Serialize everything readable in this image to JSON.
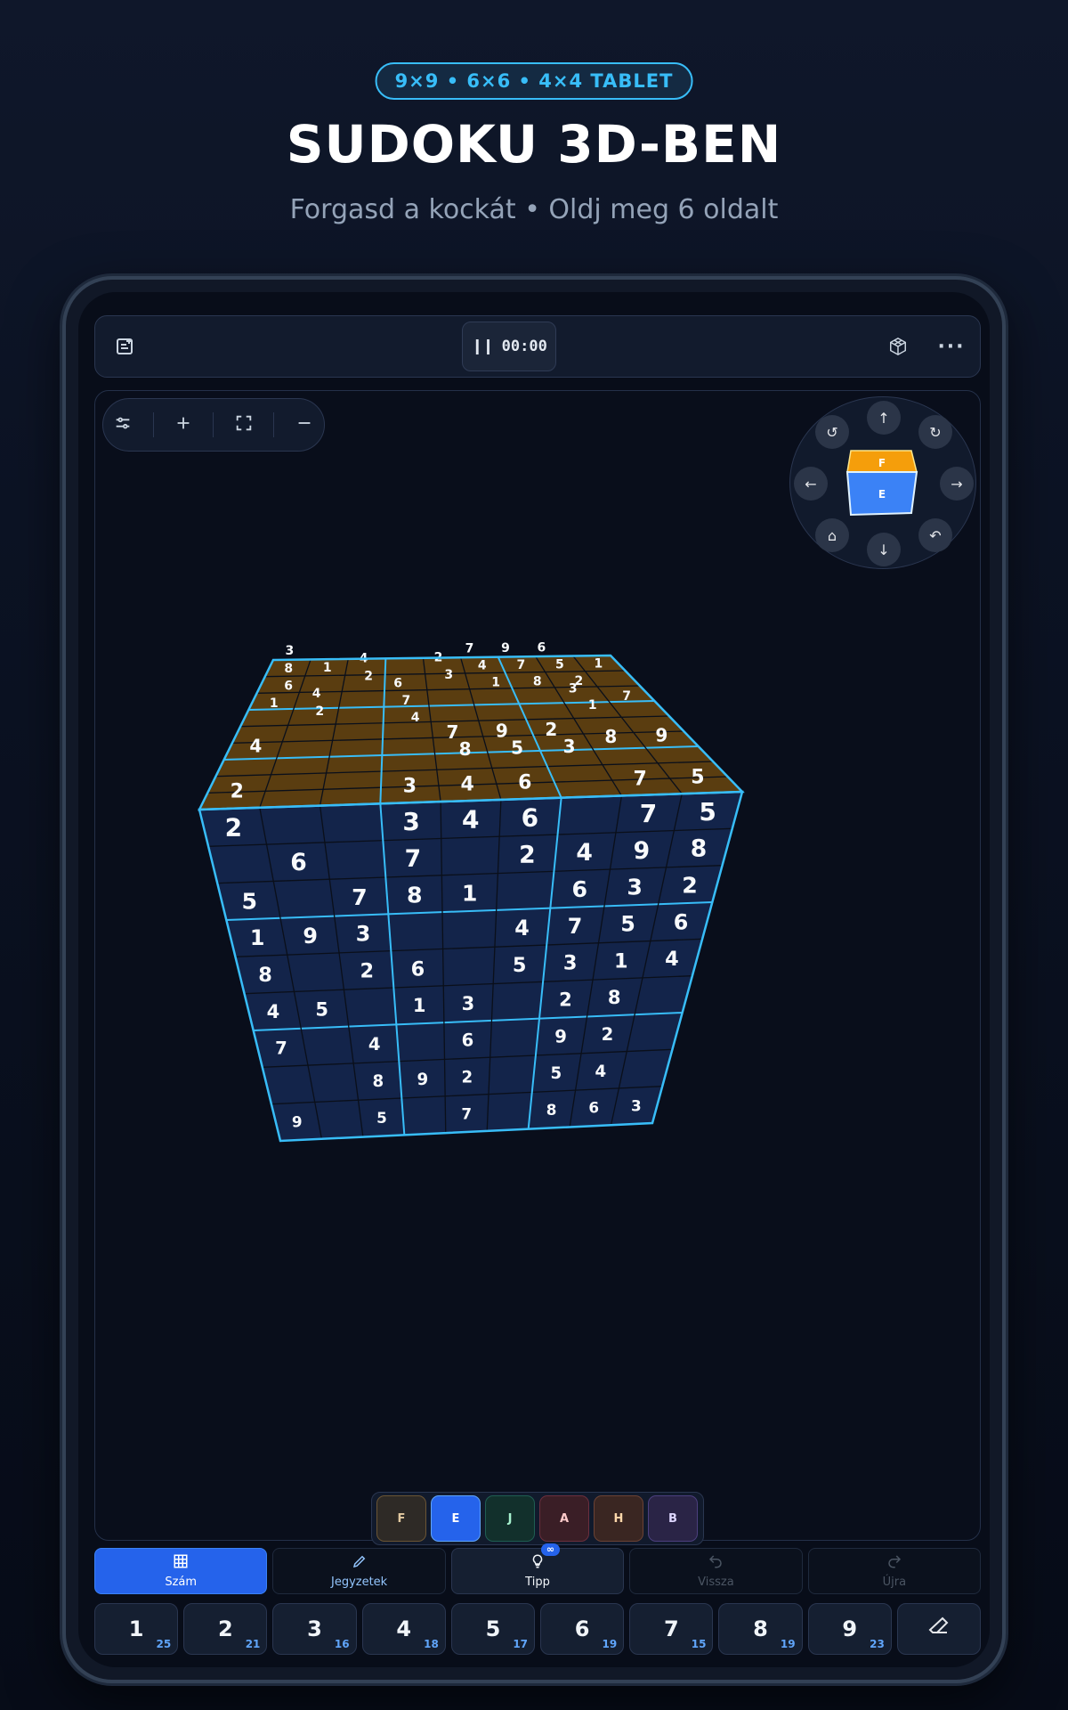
{
  "header": {
    "badge": "9×9 • 6×6 • 4×4 TABLET",
    "title": "SUDOKU 3D-BEN",
    "subtitle": "Forgasd a kockát • Oldj meg 6 oldalt"
  },
  "topbar": {
    "timer": "00:00",
    "icons": [
      "new-game-icon",
      "pause-icon",
      "cube-view-icon",
      "more-icon"
    ]
  },
  "navigator": {
    "top_face_label": "F",
    "front_face_label": "E",
    "colors": {
      "top": "#f59e0b",
      "front": "#3b82f6"
    }
  },
  "cube": {
    "top_face": [
      [
        "3 8 6",
        "1",
        "4 2",
        "",
        "2 3",
        "7 4 1",
        "9 7 8",
        "6 5 2",
        "1"
      ],
      [
        "1",
        "4 2",
        "",
        "6 7 4",
        "",
        "",
        "",
        "3 1",
        "7"
      ],
      [
        "4",
        "",
        "",
        "",
        "7 8",
        "9 5",
        "2 3",
        "8",
        "9"
      ],
      [
        "2",
        "",
        "",
        "3",
        "4",
        "6",
        "",
        "7",
        "5"
      ]
    ],
    "front_rows": [
      [
        "2",
        "",
        "",
        "3",
        "4",
        "6",
        "",
        "7",
        "5"
      ],
      [
        "",
        "6",
        "",
        "7",
        "",
        "2",
        "4",
        "9",
        "8"
      ],
      [
        "5",
        "",
        "7",
        "8",
        "1",
        "",
        "6",
        "3",
        "2"
      ],
      [
        "1",
        "9",
        "3",
        "",
        "",
        "4",
        "7",
        "5",
        "6"
      ],
      [
        "8",
        "",
        "2",
        "6",
        "",
        "5",
        "3",
        "1",
        "4"
      ],
      [
        "4",
        "5",
        "",
        "1",
        "3",
        "",
        "2",
        "8",
        ""
      ],
      [
        "7",
        "",
        "4",
        "",
        "6",
        "",
        "9",
        "2",
        ""
      ],
      [
        "",
        "",
        "8",
        "9",
        "2",
        "",
        "5",
        "4",
        ""
      ],
      [
        "9",
        "",
        "5",
        "",
        "7",
        "",
        "8",
        "6",
        "3"
      ]
    ],
    "colors": {
      "top": "#5a3d10",
      "front": "#13244a",
      "grid": "#38bdf8"
    }
  },
  "faces": [
    {
      "label": "F",
      "bg": "#2e2a26",
      "border": "#6b5534",
      "color": "#e2c9a0"
    },
    {
      "label": "E",
      "bg": "#2563eb",
      "border": "#60a5fa",
      "color": "#ffffff"
    },
    {
      "label": "J",
      "bg": "#12302c",
      "border": "#1f5e52",
      "color": "#a7f3d0"
    },
    {
      "label": "A",
      "bg": "#3a1e26",
      "border": "#6b2f3d",
      "color": "#fecaca"
    },
    {
      "label": "H",
      "bg": "#3a2622",
      "border": "#6b4234",
      "color": "#fed7aa"
    },
    {
      "label": "B",
      "bg": "#2a2446",
      "border": "#4c3f7e",
      "color": "#ddd6fe"
    }
  ],
  "modes": [
    {
      "label": "Szám",
      "icon": "grid-icon",
      "active": true
    },
    {
      "label": "Jegyzetek",
      "icon": "pencil-icon",
      "active": false
    },
    {
      "label": "Tipp",
      "icon": "lightbulb-icon",
      "badge": "∞",
      "active": false
    },
    {
      "label": "Vissza",
      "icon": "undo-icon",
      "disabled": true
    },
    {
      "label": "Újra",
      "icon": "redo-icon",
      "disabled": true
    }
  ],
  "numbers": [
    {
      "n": "1",
      "count": "25"
    },
    {
      "n": "2",
      "count": "21"
    },
    {
      "n": "3",
      "count": "16"
    },
    {
      "n": "4",
      "count": "18"
    },
    {
      "n": "5",
      "count": "17"
    },
    {
      "n": "6",
      "count": "19"
    },
    {
      "n": "7",
      "count": "15"
    },
    {
      "n": "8",
      "count": "19"
    },
    {
      "n": "9",
      "count": "23"
    }
  ]
}
